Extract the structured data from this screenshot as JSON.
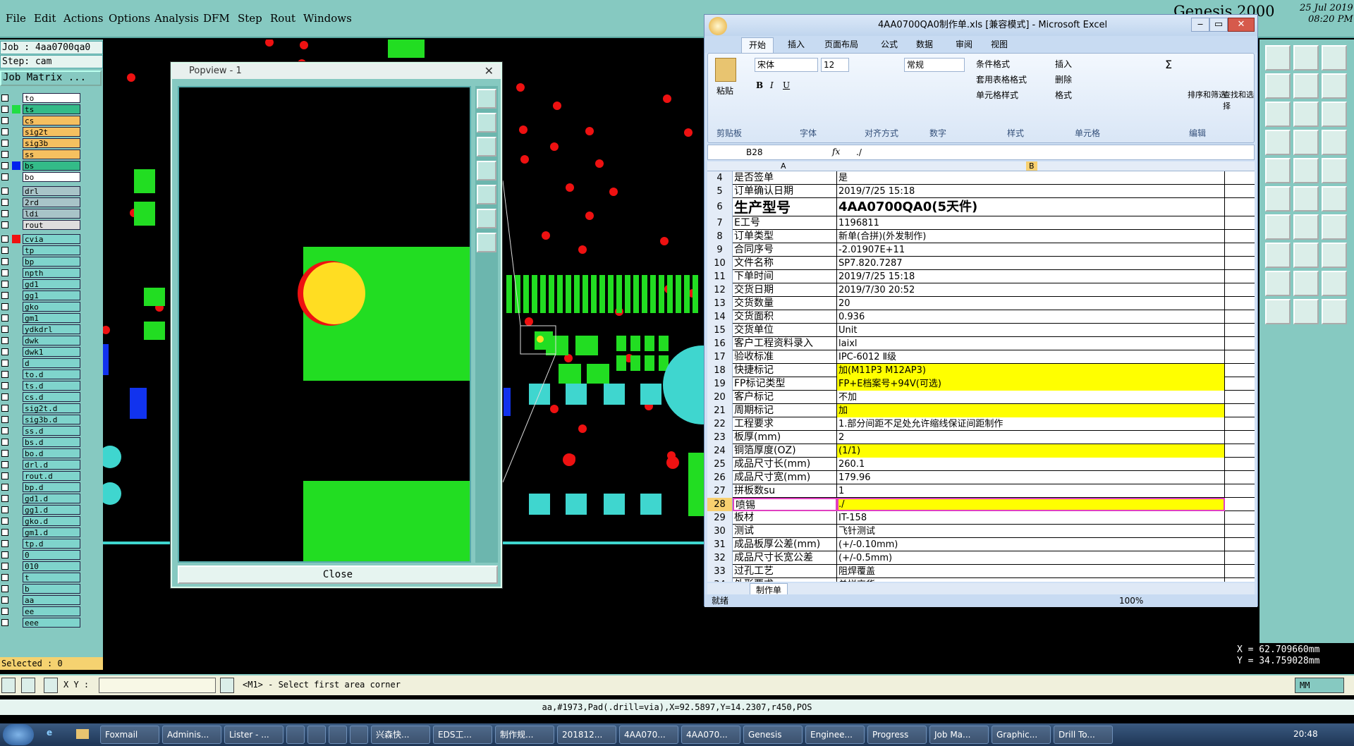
{
  "genesis": {
    "menu": [
      "File",
      "Edit",
      "Actions",
      "Options",
      "Analysis",
      "DFM",
      "Step",
      "Rout",
      "Windows"
    ],
    "title": "Genesis 2000",
    "date": "25 Jul 2019",
    "time": "08:20 PM",
    "job": "Job : 4aa0700qa0",
    "step": "Step: cam",
    "job_matrix": "Job Matrix ...",
    "selected": "Selected : 0",
    "layers": [
      {
        "name": "to",
        "bg": "#ffffff",
        "color": ""
      },
      {
        "name": "ts",
        "bg": "#33bb88",
        "color": "#22dd44"
      },
      {
        "name": "cs",
        "bg": "#f5c060",
        "color": ""
      },
      {
        "name": "sig2t",
        "bg": "#f5c060",
        "color": ""
      },
      {
        "name": "sig3b",
        "bg": "#f5c060",
        "color": ""
      },
      {
        "name": "ss",
        "bg": "#f5c060",
        "color": ""
      },
      {
        "name": "bs",
        "bg": "#33bb88",
        "color": "#0022ee"
      },
      {
        "name": "bo",
        "bg": "#ffffff",
        "color": ""
      },
      {
        "name": "drl",
        "bg": "#a8c4c8",
        "color": ""
      },
      {
        "name": "2rd",
        "bg": "#a8c4c8",
        "color": ""
      },
      {
        "name": "ldi",
        "bg": "#a8c4c8",
        "color": ""
      },
      {
        "name": "rout",
        "bg": "#dddddd",
        "color": ""
      },
      {
        "name": "cvia",
        "bg": "#7fd4cc",
        "color": "#ee1111"
      },
      {
        "name": "tp",
        "bg": "#7fd4cc",
        "color": ""
      },
      {
        "name": "bp",
        "bg": "#7fd4cc",
        "color": ""
      },
      {
        "name": "npth",
        "bg": "#7fd4cc",
        "color": ""
      },
      {
        "name": "gd1",
        "bg": "#7fd4cc",
        "color": ""
      },
      {
        "name": "gg1",
        "bg": "#7fd4cc",
        "color": ""
      },
      {
        "name": "gko",
        "bg": "#7fd4cc",
        "color": ""
      },
      {
        "name": "gm1",
        "bg": "#7fd4cc",
        "color": ""
      },
      {
        "name": "ydkdrl",
        "bg": "#7fd4cc",
        "color": ""
      },
      {
        "name": "dwk",
        "bg": "#7fd4cc",
        "color": ""
      },
      {
        "name": "dwk1",
        "bg": "#7fd4cc",
        "color": ""
      },
      {
        "name": "d",
        "bg": "#7fd4cc",
        "color": ""
      },
      {
        "name": "to.d",
        "bg": "#7fd4cc",
        "color": ""
      },
      {
        "name": "ts.d",
        "bg": "#7fd4cc",
        "color": ""
      },
      {
        "name": "cs.d",
        "bg": "#7fd4cc",
        "color": ""
      },
      {
        "name": "sig2t.d",
        "bg": "#7fd4cc",
        "color": ""
      },
      {
        "name": "sig3b.d",
        "bg": "#7fd4cc",
        "color": ""
      },
      {
        "name": "ss.d",
        "bg": "#7fd4cc",
        "color": ""
      },
      {
        "name": "bs.d",
        "bg": "#7fd4cc",
        "color": ""
      },
      {
        "name": "bo.d",
        "bg": "#7fd4cc",
        "color": ""
      },
      {
        "name": "drl.d",
        "bg": "#7fd4cc",
        "color": ""
      },
      {
        "name": "rout.d",
        "bg": "#7fd4cc",
        "color": ""
      },
      {
        "name": "bp.d",
        "bg": "#7fd4cc",
        "color": ""
      },
      {
        "name": "gd1.d",
        "bg": "#7fd4cc",
        "color": ""
      },
      {
        "name": "gg1.d",
        "bg": "#7fd4cc",
        "color": ""
      },
      {
        "name": "gko.d",
        "bg": "#7fd4cc",
        "color": ""
      },
      {
        "name": "gm1.d",
        "bg": "#7fd4cc",
        "color": ""
      },
      {
        "name": "tp.d",
        "bg": "#7fd4cc",
        "color": ""
      },
      {
        "name": "0",
        "bg": "#7fd4cc",
        "color": ""
      },
      {
        "name": "010",
        "bg": "#7fd4cc",
        "color": ""
      },
      {
        "name": "t",
        "bg": "#7fd4cc",
        "color": ""
      },
      {
        "name": "b",
        "bg": "#7fd4cc",
        "color": ""
      },
      {
        "name": "aa",
        "bg": "#7fd4cc",
        "color": ""
      },
      {
        "name": "ee",
        "bg": "#7fd4cc",
        "color": ""
      },
      {
        "name": "eee",
        "bg": "#7fd4cc",
        "color": ""
      }
    ],
    "popview_title": "Popview - 1",
    "popview_close": "Close",
    "coords_x": "X = 62.709660mm",
    "coords_y": "Y = 34.759028mm",
    "xy_label": "X Y :",
    "xy_value": "",
    "prompt": "<M1> - Select first area corner",
    "units": "MM",
    "status": "aa,#1973,Pad(.drill=via),X=92.5897,Y=14.2307,r450,POS"
  },
  "excel": {
    "title": "4AA0700QA0制作单.xls [兼容模式] - Microsoft Excel",
    "tabs": [
      "开始",
      "插入",
      "页面布局",
      "公式",
      "数据",
      "审阅",
      "视图"
    ],
    "font_name": "宋体",
    "font_size": "12",
    "number_format": "常规",
    "ribbon_groups": [
      "剪贴板",
      "字体",
      "对齐方式",
      "数字",
      "样式",
      "单元格",
      "编辑"
    ],
    "ribbon_buttons": {
      "paste": "粘贴",
      "cond_format": "条件格式",
      "table_format": "套用表格格式",
      "cell_style": "单元格样式",
      "insert": "插入",
      "delete": "删除",
      "format": "格式",
      "sort": "排序和筛选",
      "find": "查找和选择"
    },
    "name_box": "B28",
    "formula": "./",
    "col_a": "A",
    "col_b": "B",
    "rows": [
      {
        "n": "4",
        "a": "是否签单",
        "b": "是",
        "hl": ""
      },
      {
        "n": "5",
        "a": "订单确认日期",
        "b": "2019/7/25 15:18",
        "hl": ""
      },
      {
        "n": "6",
        "a": "生产型号",
        "b": "4AA0700QA0(5天件)",
        "hl": "big"
      },
      {
        "n": "7",
        "a": "E工号",
        "b": "1196811",
        "hl": ""
      },
      {
        "n": "8",
        "a": "订单类型",
        "b": "新单(合拼)(外发制作)",
        "hl": ""
      },
      {
        "n": "9",
        "a": "合同序号",
        "b": "-2.01907E+11",
        "hl": ""
      },
      {
        "n": "10",
        "a": "文件名称",
        "b": "SP7.820.7287",
        "hl": ""
      },
      {
        "n": "11",
        "a": "下单时间",
        "b": "2019/7/25 15:18",
        "hl": ""
      },
      {
        "n": "12",
        "a": "交货日期",
        "b": "2019/7/30 20:52",
        "hl": ""
      },
      {
        "n": "13",
        "a": "交货数量",
        "b": "20",
        "hl": ""
      },
      {
        "n": "14",
        "a": "交货面积",
        "b": "0.936",
        "hl": ""
      },
      {
        "n": "15",
        "a": "交货单位",
        "b": "Unit",
        "hl": ""
      },
      {
        "n": "16",
        "a": "客户工程资料录入",
        "b": "laixl",
        "hl": ""
      },
      {
        "n": "17",
        "a": "验收标准",
        "b": "IPC-6012 Ⅱ级",
        "hl": ""
      },
      {
        "n": "18",
        "a": "快捷标记",
        "b": "加(M11P3 M12AP3)",
        "hl": "yellow"
      },
      {
        "n": "19",
        "a": "FP标记类型",
        "b": "FP+E档案号+94V(可选)",
        "hl": "yellow"
      },
      {
        "n": "20",
        "a": "客户标记",
        "b": "不加",
        "hl": ""
      },
      {
        "n": "21",
        "a": "周期标记",
        "b": "加",
        "hl": "yellow"
      },
      {
        "n": "22",
        "a": "工程要求",
        "b": "1.部分间距不足处允许缩线保证间距制作",
        "hl": ""
      },
      {
        "n": "23",
        "a": "板厚(mm)",
        "b": "2",
        "hl": ""
      },
      {
        "n": "24",
        "a": "铜箔厚度(OZ)",
        "b": " (1/1)",
        "hl": "yellow"
      },
      {
        "n": "25",
        "a": "成品尺寸长(mm)",
        "b": "260.1",
        "hl": ""
      },
      {
        "n": "26",
        "a": "成品尺寸宽(mm)",
        "b": "179.96",
        "hl": ""
      },
      {
        "n": "27",
        "a": "拼板数su",
        "b": "1",
        "hl": ""
      },
      {
        "n": "28",
        "a": "喷锡",
        "b": "./",
        "hl": "sel"
      },
      {
        "n": "29",
        "a": "板材",
        "b": "IT-158",
        "hl": ""
      },
      {
        "n": "30",
        "a": "测试",
        "b": "飞针测试",
        "hl": ""
      },
      {
        "n": "31",
        "a": "成品板厚公差(mm)",
        "b": "(+/-0.10mm)",
        "hl": ""
      },
      {
        "n": "32",
        "a": "成品尺寸长宽公差",
        "b": "(+/-0.5mm)",
        "hl": ""
      },
      {
        "n": "33",
        "a": "过孔工艺",
        "b": "阻焊覆盖",
        "hl": ""
      },
      {
        "n": "34",
        "a": "外形要求",
        "b": "单拼交货",
        "hl": ""
      }
    ],
    "sheet_tab": "制作单",
    "status_ready": "就绪",
    "zoom": "100%"
  },
  "taskbar": {
    "items": [
      "Foxmail",
      "Adminis...",
      "Lister - ...",
      "",
      "",
      "",
      "",
      "兴森快...",
      "EDS工...",
      "制作规...",
      "201812...",
      "4AA070...",
      "4AA070...",
      "Genesis",
      "Enginee...",
      "Progress",
      "Job Ma...",
      "Graphic...",
      "Drill To..."
    ],
    "clock": "20:48"
  }
}
